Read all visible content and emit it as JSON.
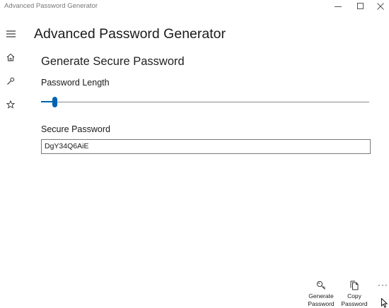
{
  "window": {
    "title": "Advanced Password Generator"
  },
  "nav": {
    "items": [
      {
        "icon": "hamburger-icon"
      },
      {
        "icon": "home-icon"
      },
      {
        "icon": "wrench-icon"
      },
      {
        "icon": "star-icon"
      }
    ]
  },
  "header": {
    "title": "Advanced Password Generator"
  },
  "main": {
    "section_title": "Generate Secure Password",
    "length_label": "Password Length",
    "length_slider_fraction": 0.04,
    "secure_label": "Secure Password",
    "password_value": "DgY34Q6AiE"
  },
  "commands": {
    "generate_label": "Generate\nPassword",
    "copy_label": "Copy\nPassword",
    "more_label": "···"
  },
  "colors": {
    "accent": "#0063b1"
  }
}
